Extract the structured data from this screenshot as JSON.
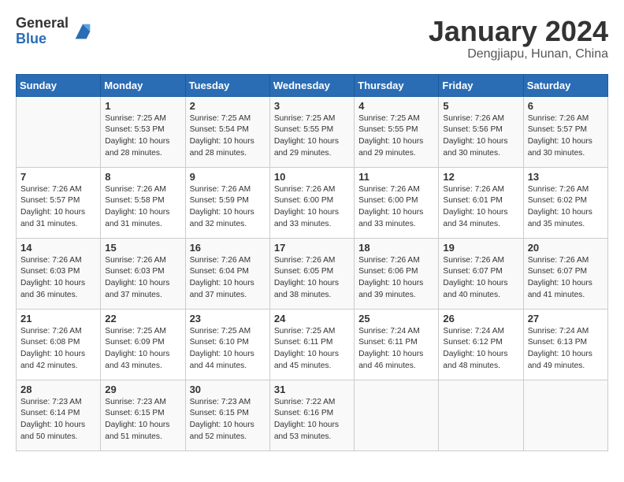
{
  "header": {
    "logo_general": "General",
    "logo_blue": "Blue",
    "month_title": "January 2024",
    "location": "Dengjiapu, Hunan, China"
  },
  "weekdays": [
    "Sunday",
    "Monday",
    "Tuesday",
    "Wednesday",
    "Thursday",
    "Friday",
    "Saturday"
  ],
  "weeks": [
    [
      {
        "day": "",
        "content": ""
      },
      {
        "day": "1",
        "content": "Sunrise: 7:25 AM\nSunset: 5:53 PM\nDaylight: 10 hours\nand 28 minutes."
      },
      {
        "day": "2",
        "content": "Sunrise: 7:25 AM\nSunset: 5:54 PM\nDaylight: 10 hours\nand 28 minutes."
      },
      {
        "day": "3",
        "content": "Sunrise: 7:25 AM\nSunset: 5:55 PM\nDaylight: 10 hours\nand 29 minutes."
      },
      {
        "day": "4",
        "content": "Sunrise: 7:25 AM\nSunset: 5:55 PM\nDaylight: 10 hours\nand 29 minutes."
      },
      {
        "day": "5",
        "content": "Sunrise: 7:26 AM\nSunset: 5:56 PM\nDaylight: 10 hours\nand 30 minutes."
      },
      {
        "day": "6",
        "content": "Sunrise: 7:26 AM\nSunset: 5:57 PM\nDaylight: 10 hours\nand 30 minutes."
      }
    ],
    [
      {
        "day": "7",
        "content": "Sunrise: 7:26 AM\nSunset: 5:57 PM\nDaylight: 10 hours\nand 31 minutes."
      },
      {
        "day": "8",
        "content": "Sunrise: 7:26 AM\nSunset: 5:58 PM\nDaylight: 10 hours\nand 31 minutes."
      },
      {
        "day": "9",
        "content": "Sunrise: 7:26 AM\nSunset: 5:59 PM\nDaylight: 10 hours\nand 32 minutes."
      },
      {
        "day": "10",
        "content": "Sunrise: 7:26 AM\nSunset: 6:00 PM\nDaylight: 10 hours\nand 33 minutes."
      },
      {
        "day": "11",
        "content": "Sunrise: 7:26 AM\nSunset: 6:00 PM\nDaylight: 10 hours\nand 33 minutes."
      },
      {
        "day": "12",
        "content": "Sunrise: 7:26 AM\nSunset: 6:01 PM\nDaylight: 10 hours\nand 34 minutes."
      },
      {
        "day": "13",
        "content": "Sunrise: 7:26 AM\nSunset: 6:02 PM\nDaylight: 10 hours\nand 35 minutes."
      }
    ],
    [
      {
        "day": "14",
        "content": "Sunrise: 7:26 AM\nSunset: 6:03 PM\nDaylight: 10 hours\nand 36 minutes."
      },
      {
        "day": "15",
        "content": "Sunrise: 7:26 AM\nSunset: 6:03 PM\nDaylight: 10 hours\nand 37 minutes."
      },
      {
        "day": "16",
        "content": "Sunrise: 7:26 AM\nSunset: 6:04 PM\nDaylight: 10 hours\nand 37 minutes."
      },
      {
        "day": "17",
        "content": "Sunrise: 7:26 AM\nSunset: 6:05 PM\nDaylight: 10 hours\nand 38 minutes."
      },
      {
        "day": "18",
        "content": "Sunrise: 7:26 AM\nSunset: 6:06 PM\nDaylight: 10 hours\nand 39 minutes."
      },
      {
        "day": "19",
        "content": "Sunrise: 7:26 AM\nSunset: 6:07 PM\nDaylight: 10 hours\nand 40 minutes."
      },
      {
        "day": "20",
        "content": "Sunrise: 7:26 AM\nSunset: 6:07 PM\nDaylight: 10 hours\nand 41 minutes."
      }
    ],
    [
      {
        "day": "21",
        "content": "Sunrise: 7:26 AM\nSunset: 6:08 PM\nDaylight: 10 hours\nand 42 minutes."
      },
      {
        "day": "22",
        "content": "Sunrise: 7:25 AM\nSunset: 6:09 PM\nDaylight: 10 hours\nand 43 minutes."
      },
      {
        "day": "23",
        "content": "Sunrise: 7:25 AM\nSunset: 6:10 PM\nDaylight: 10 hours\nand 44 minutes."
      },
      {
        "day": "24",
        "content": "Sunrise: 7:25 AM\nSunset: 6:11 PM\nDaylight: 10 hours\nand 45 minutes."
      },
      {
        "day": "25",
        "content": "Sunrise: 7:24 AM\nSunset: 6:11 PM\nDaylight: 10 hours\nand 46 minutes."
      },
      {
        "day": "26",
        "content": "Sunrise: 7:24 AM\nSunset: 6:12 PM\nDaylight: 10 hours\nand 48 minutes."
      },
      {
        "day": "27",
        "content": "Sunrise: 7:24 AM\nSunset: 6:13 PM\nDaylight: 10 hours\nand 49 minutes."
      }
    ],
    [
      {
        "day": "28",
        "content": "Sunrise: 7:23 AM\nSunset: 6:14 PM\nDaylight: 10 hours\nand 50 minutes."
      },
      {
        "day": "29",
        "content": "Sunrise: 7:23 AM\nSunset: 6:15 PM\nDaylight: 10 hours\nand 51 minutes."
      },
      {
        "day": "30",
        "content": "Sunrise: 7:23 AM\nSunset: 6:15 PM\nDaylight: 10 hours\nand 52 minutes."
      },
      {
        "day": "31",
        "content": "Sunrise: 7:22 AM\nSunset: 6:16 PM\nDaylight: 10 hours\nand 53 minutes."
      },
      {
        "day": "",
        "content": ""
      },
      {
        "day": "",
        "content": ""
      },
      {
        "day": "",
        "content": ""
      }
    ]
  ]
}
